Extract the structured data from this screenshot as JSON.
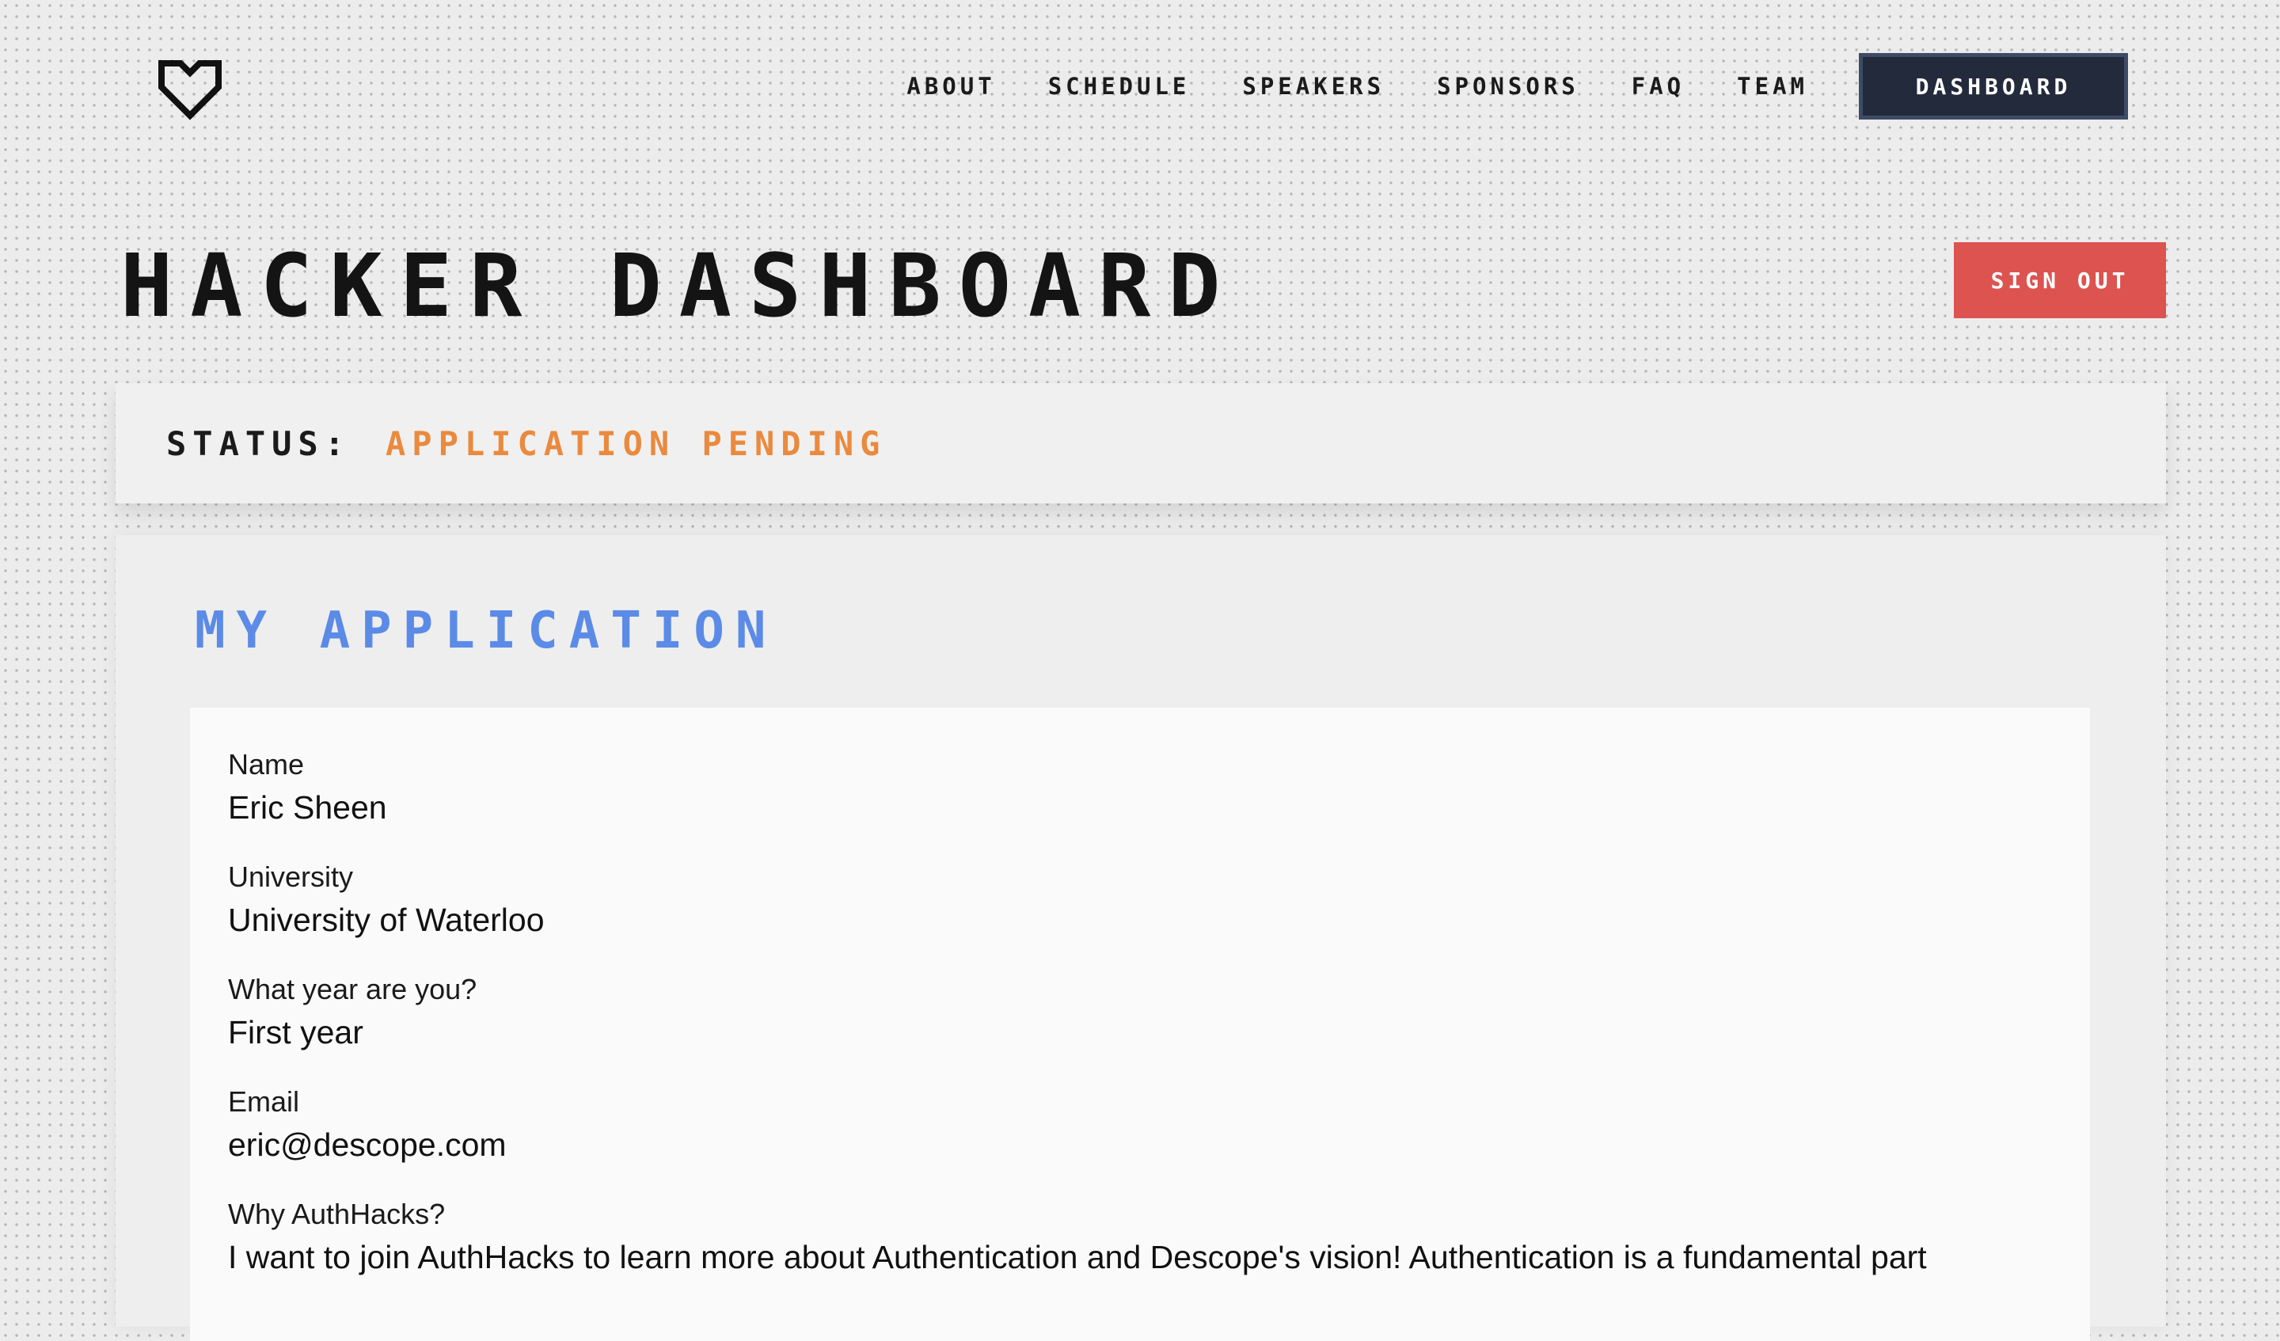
{
  "nav": {
    "logo_icon": "pixel-heart-icon",
    "links": [
      "ABOUT",
      "SCHEDULE",
      "SPEAKERS",
      "SPONSORS",
      "FAQ",
      "TEAM"
    ],
    "dashboard_label": "DASHBOARD"
  },
  "header": {
    "title": "HACKER DASHBOARD",
    "signout_label": "SIGN OUT"
  },
  "status": {
    "label": "STATUS:",
    "value": "APPLICATION PENDING",
    "value_color": "#ea8a3e"
  },
  "application": {
    "title": "MY APPLICATION",
    "title_color": "#5b8be6",
    "fields": [
      {
        "label": "Name",
        "value": "Eric Sheen"
      },
      {
        "label": "University",
        "value": "University of Waterloo"
      },
      {
        "label": "What year are you?",
        "value": "First year"
      },
      {
        "label": "Email",
        "value": "eric@descope.com"
      },
      {
        "label": "Why AuthHacks?",
        "value": "I want to join AuthHacks to learn more about Authentication and Descope's vision! Authentication is a fundamental part"
      }
    ]
  },
  "colors": {
    "signout_bg": "#dc5350",
    "dashboard_bg": "#232a3b"
  }
}
